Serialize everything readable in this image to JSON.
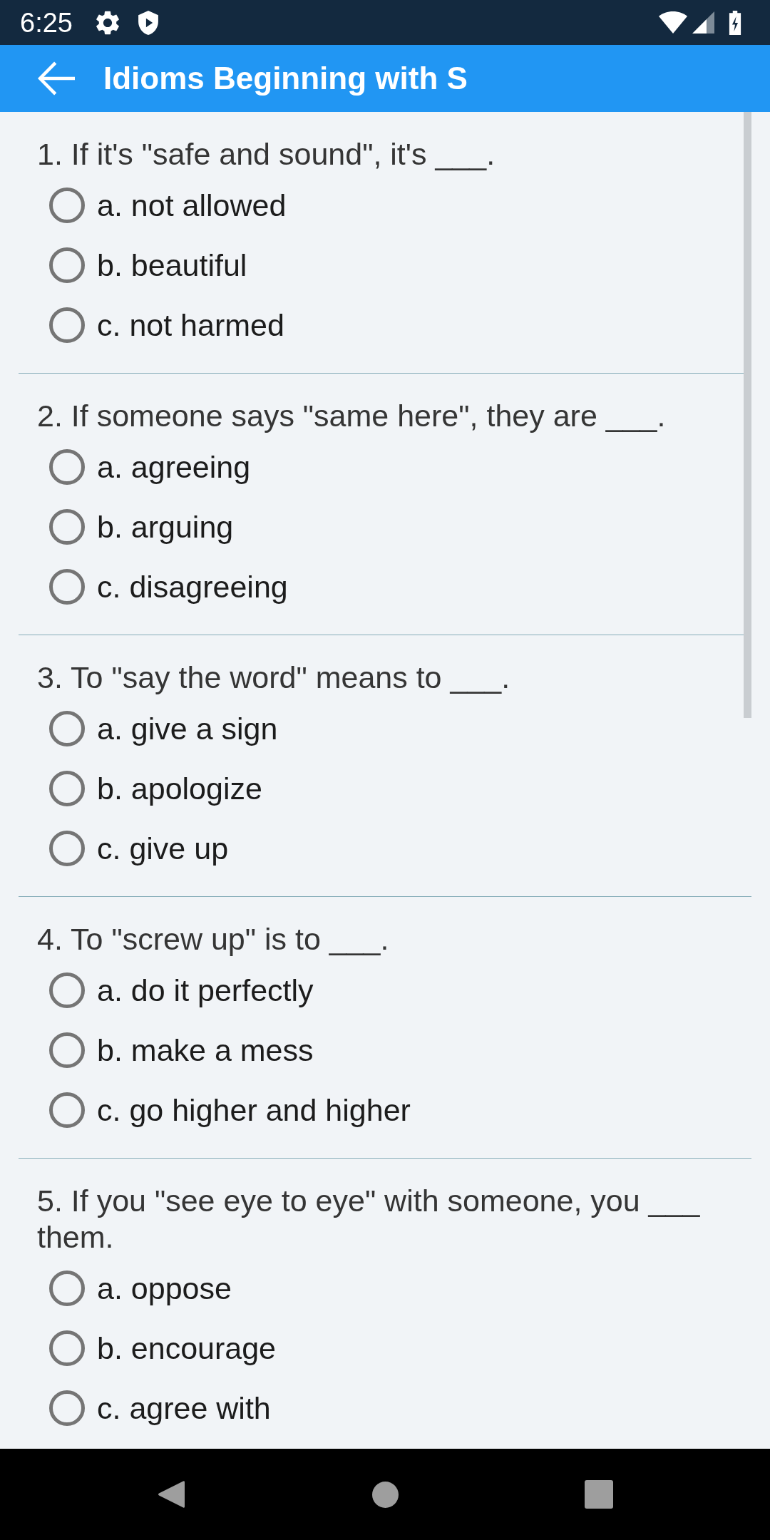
{
  "status_bar": {
    "time": "6:25"
  },
  "app_bar": {
    "title": "Idioms Beginning with S"
  },
  "questions": [
    {
      "text": "1. If it's \"safe and sound\", it's ___.",
      "options": [
        {
          "label": "a. not allowed",
          "selected": false
        },
        {
          "label": "b. beautiful",
          "selected": false
        },
        {
          "label": "c. not harmed",
          "selected": false
        }
      ]
    },
    {
      "text": "2. If someone says \"same here\", they are ___.",
      "options": [
        {
          "label": "a. agreeing",
          "selected": false
        },
        {
          "label": "b. arguing",
          "selected": false
        },
        {
          "label": "c. disagreeing",
          "selected": false
        }
      ]
    },
    {
      "text": "3. To \"say the word\" means to ___.",
      "options": [
        {
          "label": "a. give a sign",
          "selected": false
        },
        {
          "label": "b. apologize",
          "selected": false
        },
        {
          "label": "c. give up",
          "selected": false
        }
      ]
    },
    {
      "text": "4. To \"screw up\" is to ___.",
      "options": [
        {
          "label": "a. do it perfectly",
          "selected": false
        },
        {
          "label": "b. make a mess",
          "selected": false
        },
        {
          "label": "c. go higher and higher",
          "selected": false
        }
      ]
    },
    {
      "text": "5. If you \"see eye to eye\" with someone, you ___ them.",
      "options": [
        {
          "label": "a. oppose",
          "selected": false
        },
        {
          "label": "b. encourage",
          "selected": false
        },
        {
          "label": "c. agree with",
          "selected": false
        }
      ]
    }
  ]
}
